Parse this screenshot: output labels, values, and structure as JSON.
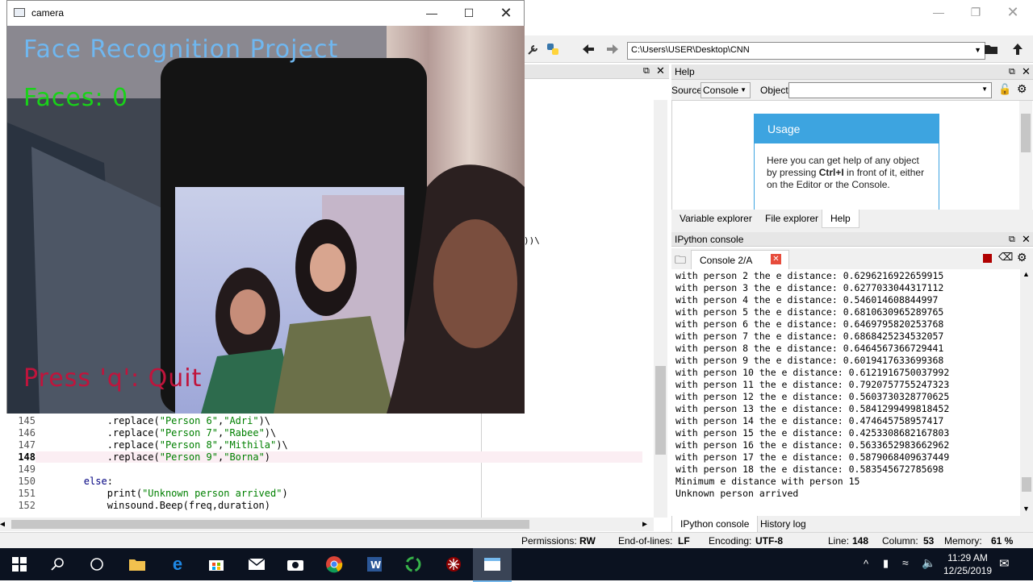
{
  "spyder": {
    "path": "C:\\Users\\USER\\Desktop\\CNN",
    "editor_lines": [
      {
        "num": "145",
        "indent": "            ",
        "parts": [
          {
            "t": ".replace(",
            "c": ""
          },
          {
            "t": "\"Person 6\"",
            "c": "str"
          },
          {
            "t": ",",
            "c": ""
          },
          {
            "t": "\"Adri\"",
            "c": "str"
          },
          {
            "t": ")\\",
            "c": ""
          }
        ]
      },
      {
        "num": "146",
        "indent": "            ",
        "parts": [
          {
            "t": ".replace(",
            "c": ""
          },
          {
            "t": "\"Person 7\"",
            "c": "str"
          },
          {
            "t": ",",
            "c": ""
          },
          {
            "t": "\"Rabee\"",
            "c": "str"
          },
          {
            "t": ")\\",
            "c": ""
          }
        ]
      },
      {
        "num": "147",
        "indent": "            ",
        "parts": [
          {
            "t": ".replace(",
            "c": ""
          },
          {
            "t": "\"Person 8\"",
            "c": "str"
          },
          {
            "t": ",",
            "c": ""
          },
          {
            "t": "\"Mithila\"",
            "c": "str"
          },
          {
            "t": ")\\",
            "c": ""
          }
        ]
      },
      {
        "num": "148",
        "indent": "            ",
        "parts": [
          {
            "t": ".replace(",
            "c": ""
          },
          {
            "t": "\"Person 9\"",
            "c": "str"
          },
          {
            "t": ",",
            "c": ""
          },
          {
            "t": "\"Borna\"",
            "c": "str"
          },
          {
            "t": ")",
            "c": ""
          }
        ]
      },
      {
        "num": "149",
        "indent": "",
        "parts": []
      },
      {
        "num": "150",
        "indent": "        ",
        "parts": [
          {
            "t": "else",
            "c": "kw"
          },
          {
            "t": ":",
            "c": ""
          }
        ]
      },
      {
        "num": "151",
        "indent": "            ",
        "parts": [
          {
            "t": "print(",
            "c": ""
          },
          {
            "t": "\"Unknown person arrived\"",
            "c": "str"
          },
          {
            "t": ")",
            "c": ""
          }
        ]
      },
      {
        "num": "152",
        "indent": "            ",
        "parts": [
          {
            "t": "winsound.Beep(freq,duration)",
            "c": ""
          }
        ]
      }
    ],
    "current_line": "148",
    "editor_fragment": "))\\",
    "help": {
      "title": "Help",
      "source_label": "Source",
      "source_value": "Console",
      "object_label": "Object",
      "usage_title": "Usage",
      "usage_text_1": "Here you can get help of any object by pressing ",
      "usage_key": "Ctrl+I",
      "usage_text_2": " in front of it, either on the Editor or the Console.",
      "tabs": [
        "Variable explorer",
        "File explorer",
        "Help"
      ]
    },
    "console": {
      "title": "IPython console",
      "tab_label": "Console 2/A",
      "lines": [
        "with person 2 the e distance: 0.6296216922659915",
        "with person 3 the e distance: 0.6277033044317112",
        "with person 4 the e distance: 0.546014608844997",
        "with person 5 the e distance: 0.6810630965289765",
        "with person 6 the e distance: 0.6469795820253768",
        "with person 7 the e distance: 0.6868425234532057",
        "with person 8 the e distance: 0.6464567366729441",
        "with person 9 the e distance: 0.6019417633699368",
        "with person 10 the e distance: 0.6121916750037992",
        "with person 11 the e distance: 0.7920757755247323",
        "with person 12 the e distance: 0.5603730328770625",
        "with person 13 the e distance: 0.5841299499818452",
        "with person 14 the e distance: 0.474645758957417",
        "with person 15 the e distance: 0.4253308682167803",
        "with person 16 the e distance: 0.5633652983662962",
        "with person 17 the e distance: 0.5879068409637449",
        "with person 18 the e distance: 0.583545672785698",
        "Minimum e distance with person 15",
        "Unknown person arrived"
      ],
      "bottom_tabs": [
        "IPython console",
        "History log"
      ]
    },
    "status": {
      "permissions_label": "Permissions:",
      "permissions": "RW",
      "eol_label": "End-of-lines:",
      "eol": "LF",
      "encoding_label": "Encoding:",
      "encoding": "UTF-8",
      "line_label": "Line:",
      "line": "148",
      "column_label": "Column:",
      "column": "53",
      "memory_label": "Memory:",
      "memory": "61 %"
    }
  },
  "camera": {
    "window_title": "camera",
    "overlay_title": "Face Recognition Project",
    "overlay_faces": "Faces: 0",
    "overlay_quit": "Press 'q': Quit"
  },
  "taskbar": {
    "time": "11:29 AM",
    "date": "12/25/2019"
  }
}
